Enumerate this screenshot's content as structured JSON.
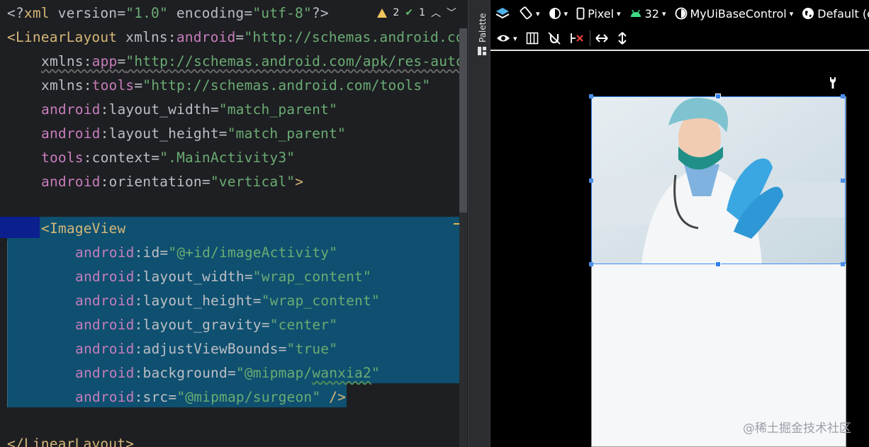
{
  "editor": {
    "inspection": {
      "warnings": "2",
      "checks": "1"
    },
    "lines": [
      [
        "<?xml version=\"1.0\" encoding=\"utf-8\"?>"
      ],
      [
        "<LinearLayout xmlns:android=\"http://schemas.android.co"
      ],
      [
        "xmlns:app=\"http://schemas.android.com/apk/res-auto"
      ],
      [
        "xmlns:tools=\"http://schemas.android.com/tools\""
      ],
      [
        "android:layout_width=\"match_parent\""
      ],
      [
        "android:layout_height=\"match_parent\""
      ],
      [
        "tools:context=\".MainActivity3\""
      ],
      [
        "android:orientation=\"vertical\">"
      ],
      [
        ""
      ],
      [
        "<ImageView"
      ],
      [
        "android:id=\"@+id/imageActivity\""
      ],
      [
        "android:layout_width=\"wrap_content\""
      ],
      [
        "android:layout_height=\"wrap_content\""
      ],
      [
        "android:layout_gravity=\"center\""
      ],
      [
        "android:adjustViewBounds=\"true\""
      ],
      [
        "android:background=\"@mipmap/wanxia2\""
      ],
      [
        "android:src=\"@mipmap/surgeon\" />"
      ],
      [
        ""
      ],
      [
        "</LinearLayout>"
      ]
    ]
  },
  "palette": {
    "label": "Palette"
  },
  "design_toolbar": {
    "device": "Pixel",
    "api_level": "32",
    "theme": "MyUiBaseControl",
    "locale": "Default (en"
  },
  "watermark": "@稀土掘金技术社区",
  "colors": {
    "selection": "#0f5070",
    "accent": "#2f80ed",
    "tag": "#d5b778",
    "namespace": "#c77dbb",
    "string": "#6aab73"
  },
  "icons": [
    "warning-icon",
    "check-icon",
    "layers-icon",
    "rotate-icon",
    "night-mode-icon",
    "phone-icon",
    "android-icon",
    "theme-icon",
    "globe-icon",
    "eye-icon",
    "blueprint-icon",
    "magnet-off-icon",
    "clear-constraints-icon",
    "horizontal-arrow-icon",
    "vertical-arrow-icon",
    "wrench-icon"
  ]
}
